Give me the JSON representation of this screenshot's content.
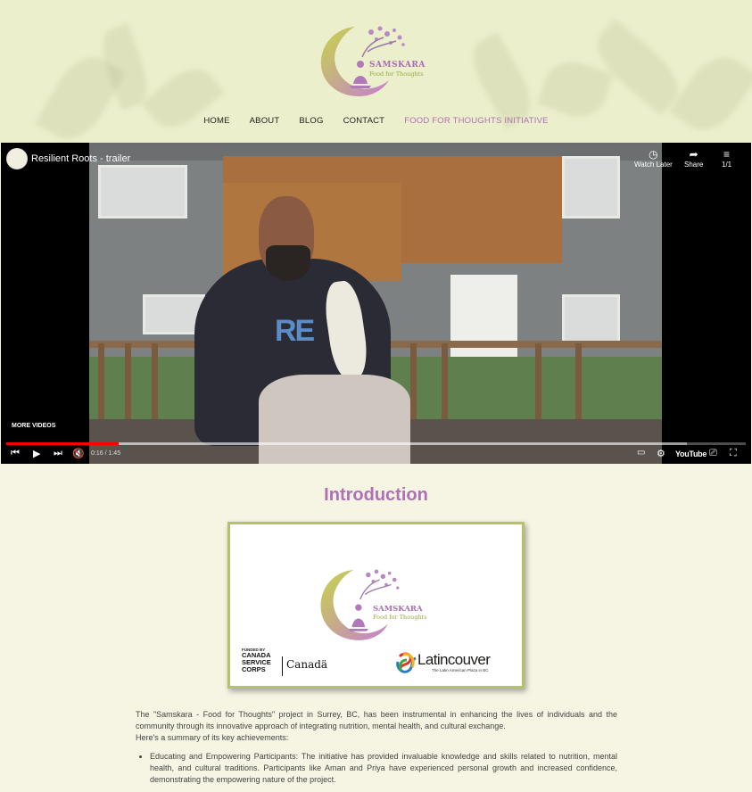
{
  "logo": {
    "brand": "SAMSKARA",
    "tagline": "Food for Thoughts"
  },
  "nav": {
    "items": [
      "HOME",
      "ABOUT",
      "BLOG",
      "CONTACT",
      "FOOD FOR THOUGHTS INITIATIVE"
    ]
  },
  "video": {
    "title": "Resilient Roots - trailer",
    "watch_later": "Watch Later",
    "share": "Share",
    "playlist": "1/1",
    "more_videos": "MORE VIDEOS",
    "time": "0:16 / 1:45",
    "progress_fraction": 0.152,
    "buffer_fraction": 0.92,
    "youtube_label": "YouTube",
    "shirt_text": "RE"
  },
  "intro": {
    "title": "Introduction",
    "card": {
      "brand": "SAMSKARA",
      "tagline": "Food for Thoughts",
      "funded_by": "FUNDED BY",
      "csc_line1": "CANADA",
      "csc_line2": "SERVICE",
      "csc_line3": "CORPS",
      "canada": "Canadä",
      "latincouver": "Latincouver",
      "latincouver_sub": "The Latin American Plaza in BC"
    },
    "paragraph1": "The \"Samskara - Food for Thoughts\" project in Surrey, BC, has been instrumental in enhancing the lives of individuals and the community through its innovative approach of integrating nutrition, mental health, and cultural exchange.",
    "paragraph2": "Here's a summary of its key achievements:",
    "bullets": [
      "Educating and Empowering Participants: The initiative has provided invaluable knowledge and skills related to nutrition, mental health, and cultural traditions. Participants like Aman and Priya have experienced personal growth and increased confidence, demonstrating the empowering nature of the project."
    ]
  },
  "colors": {
    "header_bg": "#ebefcb",
    "page_bg": "#f6f4e2",
    "accent_purple": "#b06fb7",
    "accent_green": "#b3c26b",
    "progress_red": "#ff0000"
  },
  "icons": {
    "watch_later": "clock-icon",
    "share": "share-arrow-icon",
    "playlist": "playlist-icon",
    "prev": "skip-previous-icon",
    "play": "play-icon",
    "next": "skip-next-icon",
    "mute": "volume-muted-icon",
    "subtitles": "subtitles-icon",
    "settings": "gear-icon",
    "cast": "cast-icon",
    "fullscreen": "fullscreen-icon"
  }
}
